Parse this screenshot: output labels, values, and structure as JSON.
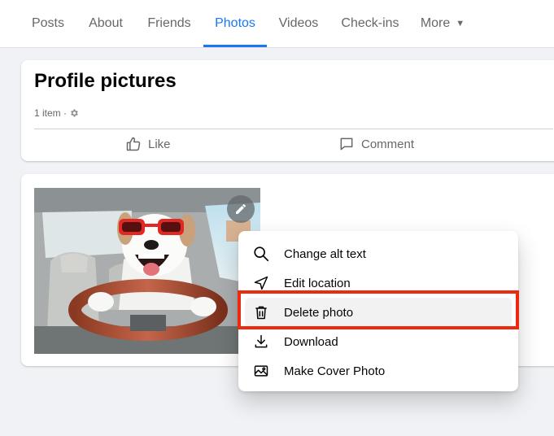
{
  "nav": {
    "tabs": [
      {
        "label": "Posts"
      },
      {
        "label": "About"
      },
      {
        "label": "Friends"
      },
      {
        "label": "Photos"
      },
      {
        "label": "Videos"
      },
      {
        "label": "Check-ins"
      },
      {
        "label": "More"
      }
    ],
    "active_tab": "Photos"
  },
  "album": {
    "title": "Profile pictures",
    "meta": "1 item ·",
    "like_label": "Like",
    "comment_label": "Comment"
  },
  "menu": {
    "items": [
      {
        "label": "Change alt text",
        "icon": "search-icon"
      },
      {
        "label": "Edit location",
        "icon": "location-arrow-icon"
      },
      {
        "label": "Delete photo",
        "icon": "trash-icon"
      },
      {
        "label": "Download",
        "icon": "download-icon"
      },
      {
        "label": "Make Cover Photo",
        "icon": "image-icon"
      }
    ],
    "highlighted_item": "Delete photo"
  },
  "colors": {
    "accent": "#1877f2",
    "highlight_border": "#ec2a0f",
    "secondary_text": "#65676b"
  }
}
